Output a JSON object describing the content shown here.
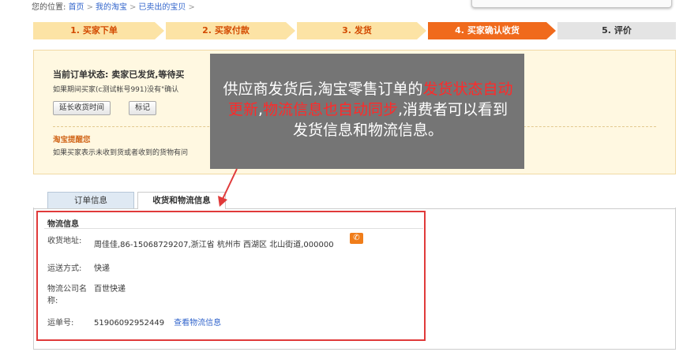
{
  "breadcrumb": {
    "prefix": "您的位置:",
    "items": [
      "首页",
      "我的淘宝",
      "已卖出的宝贝"
    ]
  },
  "steps": [
    {
      "label": "1. 买家下单",
      "state": "done"
    },
    {
      "label": "2. 买家付款",
      "state": "done"
    },
    {
      "label": "3. 发货",
      "state": "done"
    },
    {
      "label": "4. 买家确认收货",
      "state": "active"
    },
    {
      "label": "5. 评价",
      "state": "todo"
    }
  ],
  "status": {
    "title": "当前订单状态:  卖家已发货,等待买",
    "desc": "如果期间买家(c测试帐号991)没有\"确认",
    "extend_button": "延长收货时间",
    "mark_button": "标记",
    "reminder_title": "淘宝提醒您",
    "reminder_text": "如果买家表示未收到货或者收到的货物有问"
  },
  "overlay": {
    "part1": "供应商发货后,淘宝零售订单的",
    "part2": "发货状态自动更新",
    "part3": ",",
    "part4": "物流信息也自动同步",
    "part5": ",消费者可以看到发货信息和物流信息。"
  },
  "tabs": [
    {
      "label": "订单信息",
      "active": false
    },
    {
      "label": "收货和物流信息",
      "active": true
    }
  ],
  "logistics": {
    "section_title": "物流信息",
    "address_label": "收货地址:",
    "address_value": "周佳佳,86-15068729207,浙江省 杭州市 西湖区 北山街道,000000",
    "shipping_label": "运送方式:",
    "shipping_value": "快递",
    "company_label_1": "物流公司名",
    "company_label_2": "称:",
    "company_value": "百世快递",
    "tracking_label": "运单号:",
    "tracking_value": "51906092952449",
    "tracking_link": "查看物流信息"
  },
  "colors": {
    "step_done": "#fce3a5",
    "step_active": "#f06a1c",
    "step_todo": "#e4e4e4",
    "highlight_red": "#ff2a2a",
    "frame_red": "#e03a3a",
    "link_blue": "#3366cc"
  },
  "icons": {
    "phone": "phone-icon"
  }
}
